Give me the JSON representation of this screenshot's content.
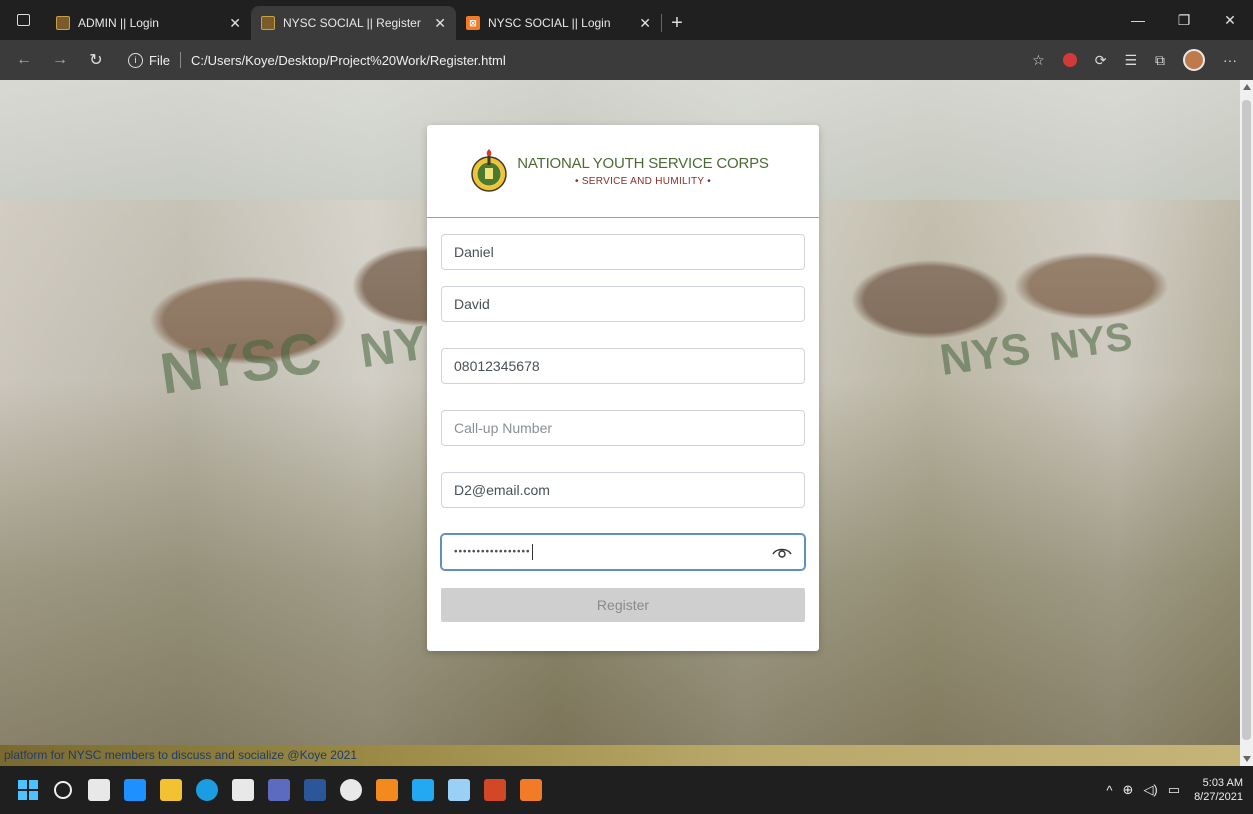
{
  "browser": {
    "tabs": [
      {
        "title": "ADMIN || Login",
        "favicon": "nysc-logo-icon",
        "active": false
      },
      {
        "title": "NYSC SOCIAL || Register",
        "favicon": "nysc-logo-icon",
        "active": true
      },
      {
        "title": "NYSC SOCIAL || Login",
        "favicon": "xampp-icon",
        "active": false
      }
    ],
    "url_label": "File",
    "url": "C:/Users/Koye/Desktop/Project%20Work/Register.html"
  },
  "brand": {
    "name": "NATIONAL YOUTH SERVICE CORPS",
    "motto": "• SERVICE AND HUMILITY •",
    "accent": "#4b6b36",
    "motto_color": "#8b2b2b"
  },
  "form": {
    "first_name": "Daniel",
    "last_name": "David",
    "phone": "08012345678",
    "callup_placeholder": "Call-up Number",
    "email": "D2@email.com",
    "password_masked": "•••••••••••••••••",
    "register_label": "Register"
  },
  "footer": {
    "text": "platform for NYSC members to discuss and socialize @Koye 2021"
  },
  "taskbar": {
    "time": "5:03 AM",
    "date": "8/27/2021"
  }
}
